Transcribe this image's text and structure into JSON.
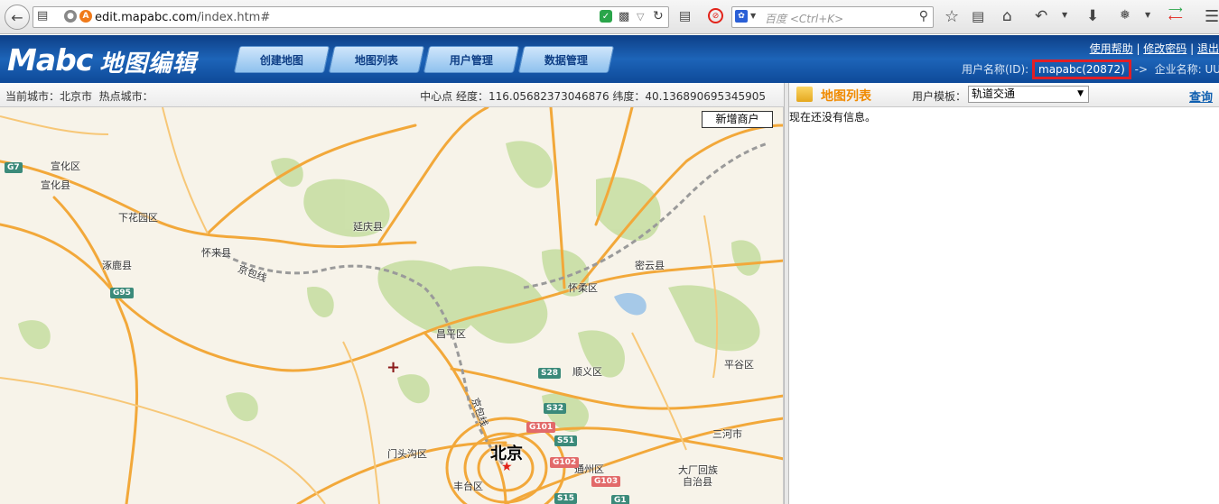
{
  "browser": {
    "url_domain": "edit.mapabc.com",
    "url_path": "/index.htm#",
    "search_placeholder": "百度 <Ctrl+K>"
  },
  "header": {
    "logo": "Mabc",
    "logo_cn": "地图编辑",
    "nav": [
      "创建地图",
      "地图列表",
      "用户管理",
      "数据管理"
    ],
    "links": {
      "help": "使用帮助",
      "change_password": "修改密码",
      "logout": "退出"
    },
    "user_label": "用户名称(ID):",
    "user_id": "mapabc(20872)",
    "arrow": "->",
    "company_label": "企业名称:",
    "company_value": "UUt"
  },
  "map_toolbar": {
    "current_city": "当前城市：北京市",
    "hot_city": "热点城市：",
    "center_text": "中心点 经度：116.05682373046876 纬度：40.136890695345905"
  },
  "map": {
    "add_merchant": "新增商户",
    "city_label": "北京",
    "places": [
      "宣化区",
      "宣化县",
      "下花园区",
      "涿鹿县",
      "怀来县",
      "延庆县",
      "京包线",
      "密云县",
      "怀柔区",
      "昌平区",
      "顺义区",
      "平谷区",
      "门头沟区",
      "通州区",
      "三河市",
      "大厂回族",
      "自治县",
      "丰台区",
      "京包线"
    ],
    "shields": [
      "G7",
      "G95",
      "S28",
      "S32",
      "G101",
      "S51",
      "G102",
      "G103",
      "S15",
      "G1"
    ]
  },
  "panel": {
    "title": "地图列表",
    "template_label": "用户模板：",
    "template_value": "轨道交通",
    "query": "查询",
    "empty_message": "现在还没有信息。"
  }
}
